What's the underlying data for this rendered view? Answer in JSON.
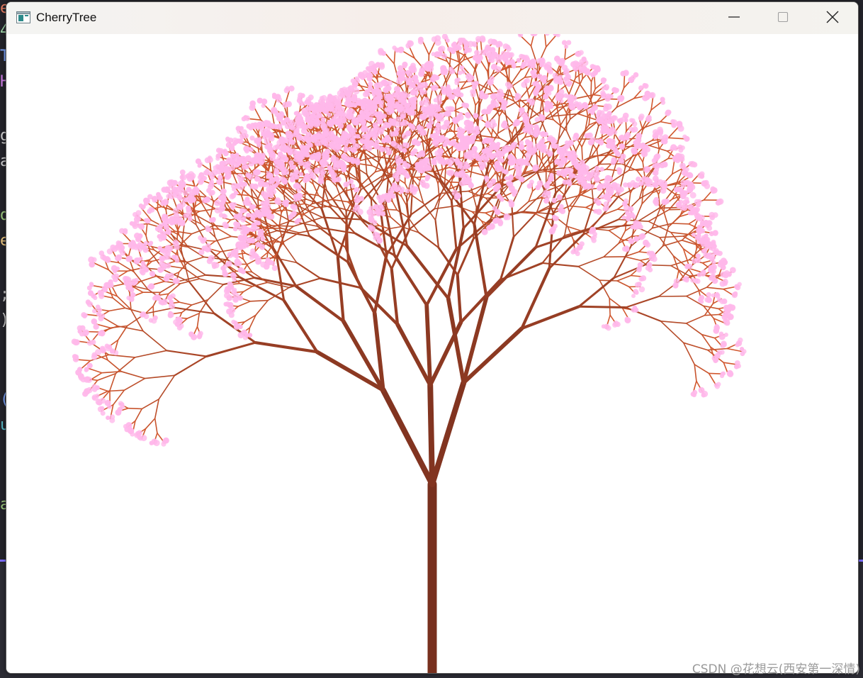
{
  "window": {
    "title": "CherryTree",
    "controls": {
      "minimize": "minimize-icon",
      "maximize": "maximize-icon",
      "close": "close-icon"
    }
  },
  "canvas": {
    "background": "#ffffff",
    "trunk_color": "#78301e",
    "branch_tip_color": "#d2582f",
    "blossom_color": "#ffb8ea"
  },
  "watermark": "CSDN @花想云(西安第一深情)"
}
